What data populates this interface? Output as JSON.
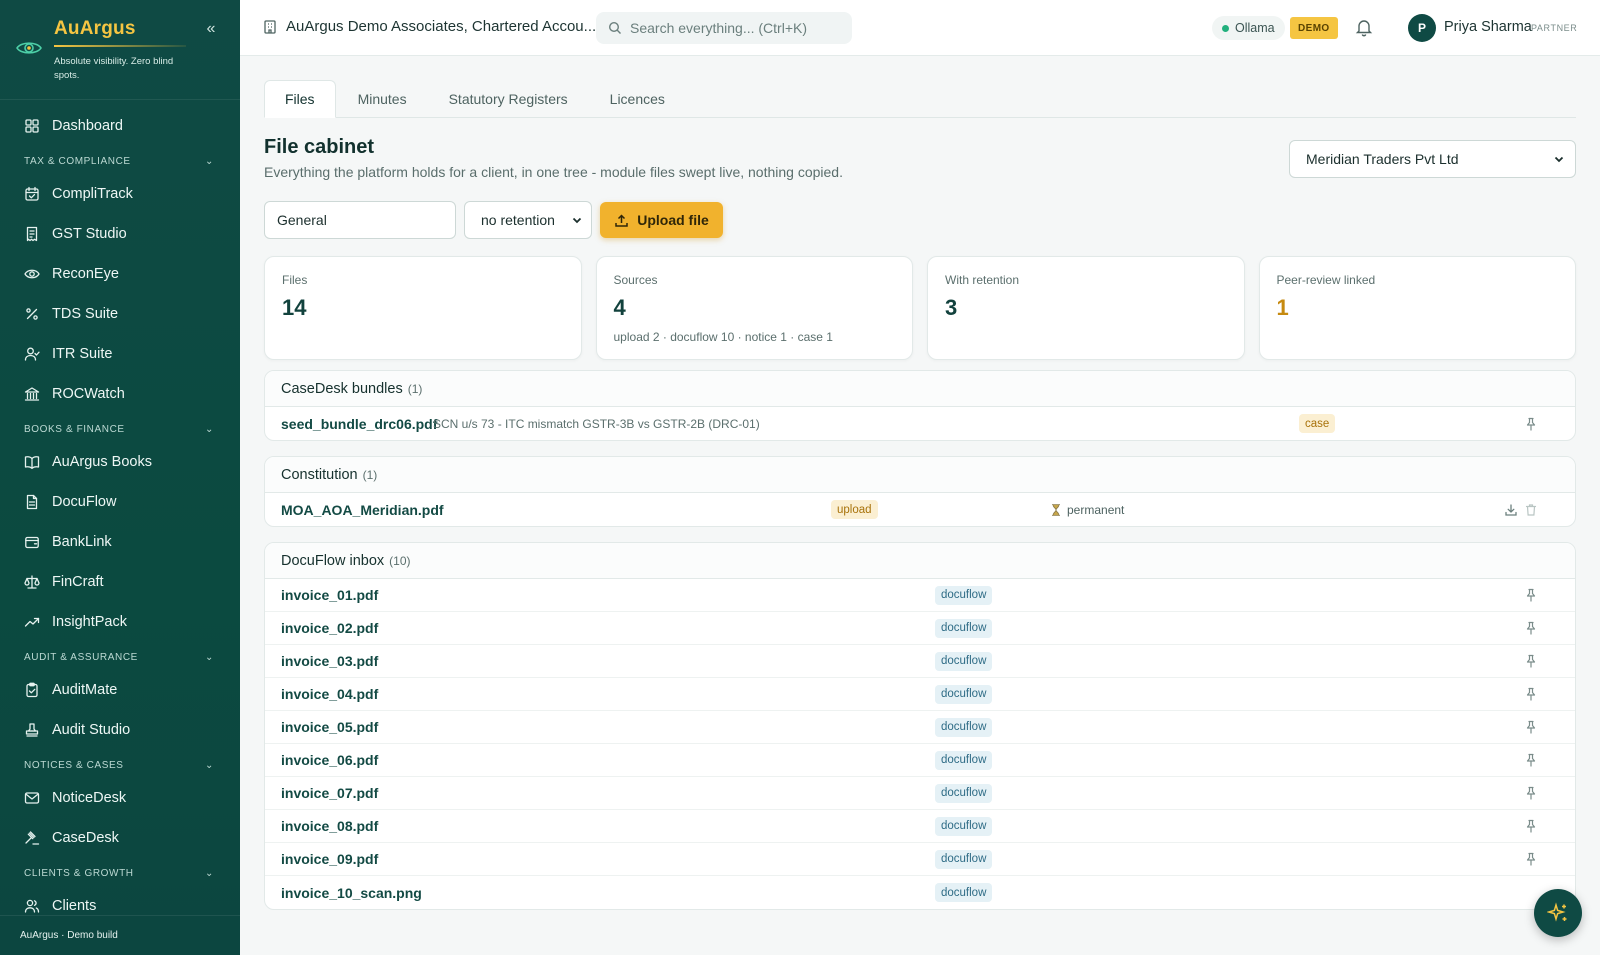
{
  "brand": {
    "name": "AuArgus",
    "tagline": "Absolute visibility. Zero blind spots.",
    "footer": "AuArgus · Demo build"
  },
  "sidebar": {
    "items": [
      {
        "label": "Dashboard",
        "icon": "grid-icon"
      },
      {
        "section": "TAX & COMPLIANCE"
      },
      {
        "label": "CompliTrack",
        "icon": "calendar-check-icon"
      },
      {
        "label": "GST Studio",
        "icon": "receipt-icon"
      },
      {
        "label": "ReconEye",
        "icon": "eye-icon"
      },
      {
        "label": "TDS Suite",
        "icon": "percent-icon"
      },
      {
        "label": "ITR Suite",
        "icon": "user-check-icon"
      },
      {
        "label": "ROCWatch",
        "icon": "landmark-icon"
      },
      {
        "section": "BOOKS & FINANCE"
      },
      {
        "label": "AuArgus Books",
        "icon": "book-open-icon"
      },
      {
        "label": "DocuFlow",
        "icon": "file-text-icon"
      },
      {
        "label": "BankLink",
        "icon": "wallet-icon"
      },
      {
        "label": "FinCraft",
        "icon": "scale-icon"
      },
      {
        "label": "InsightPack",
        "icon": "trending-up-icon"
      },
      {
        "section": "AUDIT & ASSURANCE"
      },
      {
        "label": "AuditMate",
        "icon": "clipboard-check-icon"
      },
      {
        "label": "Audit Studio",
        "icon": "stamp-icon"
      },
      {
        "section": "NOTICES & CASES"
      },
      {
        "label": "NoticeDesk",
        "icon": "mail-icon"
      },
      {
        "label": "CaseDesk",
        "icon": "gavel-icon"
      },
      {
        "section": "CLIENTS & GROWTH"
      },
      {
        "label": "Clients",
        "icon": "users-icon"
      }
    ]
  },
  "topbar": {
    "firm": "AuArgus Demo Associates, Chartered Accou...",
    "search_placeholder": "Search everything... (Ctrl+K)",
    "ollama": "Ollama",
    "demo_badge": "DEMO",
    "user_initial": "P",
    "user_name": "Priya Sharma",
    "user_role": "PARTNER",
    "status_color": "#22b07d"
  },
  "tabs": [
    "Files",
    "Minutes",
    "Statutory Registers",
    "Licences"
  ],
  "page": {
    "title": "File cabinet",
    "subtitle": "Everything the platform holds for a client, in one tree - module files swept live, nothing copied.",
    "client": "Meridian Traders Pvt Ltd",
    "folder_value": "General",
    "retention_value": "no retention",
    "upload_label": "Upload file"
  },
  "stats": [
    {
      "label": "Files",
      "value": "14",
      "sub": ""
    },
    {
      "label": "Sources",
      "value": "4",
      "sub": "upload 2 · docuflow 10 · notice 1 · case 1"
    },
    {
      "label": "With retention",
      "value": "3",
      "sub": ""
    },
    {
      "label": "Peer-review linked",
      "value": "1",
      "sub": ""
    }
  ],
  "groups": [
    {
      "title": "CaseDesk bundles",
      "count": "(1)",
      "files": [
        {
          "name": "seed_bundle_drc06.pdf",
          "desc": "SCN u/s 73 - ITC mismatch GSTR-3B vs GSTR-2B (DRC-01)",
          "tag": "case"
        }
      ]
    },
    {
      "title": "Constitution",
      "count": "(1)",
      "files": [
        {
          "name": "MOA_AOA_Meridian.pdf",
          "desc": "",
          "tag": "upload",
          "retention": "permanent"
        }
      ]
    },
    {
      "title": "DocuFlow inbox",
      "count": "(10)",
      "files": [
        {
          "name": "invoice_01.pdf",
          "tag": "docuflow"
        },
        {
          "name": "invoice_02.pdf",
          "tag": "docuflow"
        },
        {
          "name": "invoice_03.pdf",
          "tag": "docuflow"
        },
        {
          "name": "invoice_04.pdf",
          "tag": "docuflow"
        },
        {
          "name": "invoice_05.pdf",
          "tag": "docuflow"
        },
        {
          "name": "invoice_06.pdf",
          "tag": "docuflow"
        },
        {
          "name": "invoice_07.pdf",
          "tag": "docuflow"
        },
        {
          "name": "invoice_08.pdf",
          "tag": "docuflow"
        },
        {
          "name": "invoice_09.pdf",
          "tag": "docuflow"
        },
        {
          "name": "invoice_10_scan.png",
          "tag": "docuflow"
        }
      ]
    }
  ],
  "colors": {
    "sidebar": "#0f4a44",
    "accent": "#f1b22d",
    "brand_text": "#f5c542"
  }
}
